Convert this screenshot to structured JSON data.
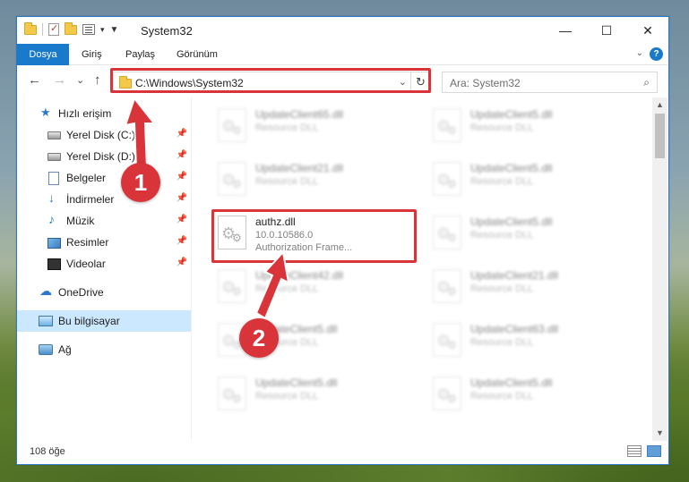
{
  "window": {
    "title": "System32",
    "controls": {
      "minimize": "—",
      "maximize": "☐",
      "close": "✕"
    }
  },
  "ribbon": {
    "tabs": [
      "Dosya",
      "Giriş",
      "Paylaş",
      "Görünüm"
    ],
    "help": "?"
  },
  "nav": {
    "back": "←",
    "forward": "→",
    "recent": "⌄",
    "up": "↑",
    "address": "C:\\Windows\\System32",
    "refresh": "↻",
    "search_placeholder": "Ara: System32",
    "search_icon": "⌕"
  },
  "sidebar": {
    "items": [
      {
        "label": "Hızlı erişim",
        "icon": "star-icon",
        "pinned": false,
        "selected": false
      },
      {
        "label": "Yerel Disk (C:)",
        "icon": "disk-icon",
        "pinned": true,
        "selected": false
      },
      {
        "label": "Yerel Disk (D:)",
        "icon": "disk-icon",
        "pinned": true,
        "selected": false
      },
      {
        "label": "Belgeler",
        "icon": "documents-icon",
        "pinned": true,
        "selected": false
      },
      {
        "label": "İndirmeler",
        "icon": "download-icon",
        "pinned": true,
        "selected": false
      },
      {
        "label": "Müzik",
        "icon": "music-icon",
        "pinned": true,
        "selected": false
      },
      {
        "label": "Resimler",
        "icon": "pictures-icon",
        "pinned": true,
        "selected": false
      },
      {
        "label": "Videolar",
        "icon": "videos-icon",
        "pinned": true,
        "selected": false
      },
      {
        "label": "OneDrive",
        "icon": "cloud-icon",
        "pinned": false,
        "selected": false
      },
      {
        "label": "Bu bilgisayar",
        "icon": "computer-icon",
        "pinned": false,
        "selected": true
      },
      {
        "label": "Ağ",
        "icon": "network-icon",
        "pinned": false,
        "selected": false
      }
    ],
    "pin_glyph": "📌"
  },
  "files": {
    "left": [
      {
        "name": "UpdateClient65.dll",
        "type": "Resource DLL"
      },
      {
        "name": "UpdateClient21.dll",
        "type": "Resource DLL"
      },
      {
        "name": "authz.dll",
        "version": "10.0.10586.0",
        "description": "Authorization Frame..."
      },
      {
        "name": "UpdateClient42.dll",
        "type": "Resource DLL"
      },
      {
        "name": "UpdateClient5.dll",
        "type": "Resource DLL"
      },
      {
        "name": "UpdateClient5.dll",
        "type": "Resource DLL"
      }
    ],
    "right": [
      {
        "name": "UpdateClient5.dll",
        "type": "Resource DLL"
      },
      {
        "name": "UpdateClient5.dll",
        "type": "Resource DLL"
      },
      {
        "name": "UpdateClient5.dll",
        "type": "Resource DLL"
      },
      {
        "name": "UpdateClient21.dll",
        "type": "Resource DLL"
      },
      {
        "name": "UpdateClient63.dll",
        "type": "Resource DLL"
      },
      {
        "name": "UpdateClient5.dll",
        "type": "Resource DLL"
      }
    ]
  },
  "status": {
    "count": "108 öğe"
  },
  "callouts": {
    "one": "1",
    "two": "2",
    "color": "#d9343a"
  },
  "colors": {
    "accent": "#1979ca",
    "selection": "#cce8ff"
  }
}
